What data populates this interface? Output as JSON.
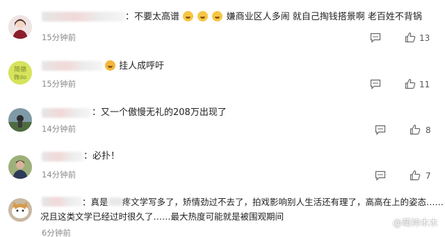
{
  "comments": [
    {
      "text_before": "：不要太高谱",
      "text_after": "嫌商业区人多闹 就自己掏钱搭景啊 老百姓不背锅",
      "time": "15分钟前",
      "likes": "13"
    },
    {
      "text": "挂人成呼吁",
      "time": "15分钟前",
      "likes": "11"
    },
    {
      "text": "：又一个傲慢无礼的208万出现了",
      "time": "14分钟前",
      "likes": "8"
    },
    {
      "text": "：必扑！",
      "time": "14分钟前",
      "likes": "7"
    },
    {
      "text_line1_a": "：真是",
      "text_line1_b": "疼文学写多了，矫情劲过不去了，拍戏影响别人生活还有理了，高高在上的姿态……",
      "text_line2": "况且这类文学已经过时很久了……最大热度可能就是被围观期间",
      "time": "6分钟前"
    }
  ],
  "avatar2_text": "简德\n微do",
  "watermark": "@萌神木木",
  "icons": [
    "comment-icon",
    "thumbs-up-icon"
  ]
}
